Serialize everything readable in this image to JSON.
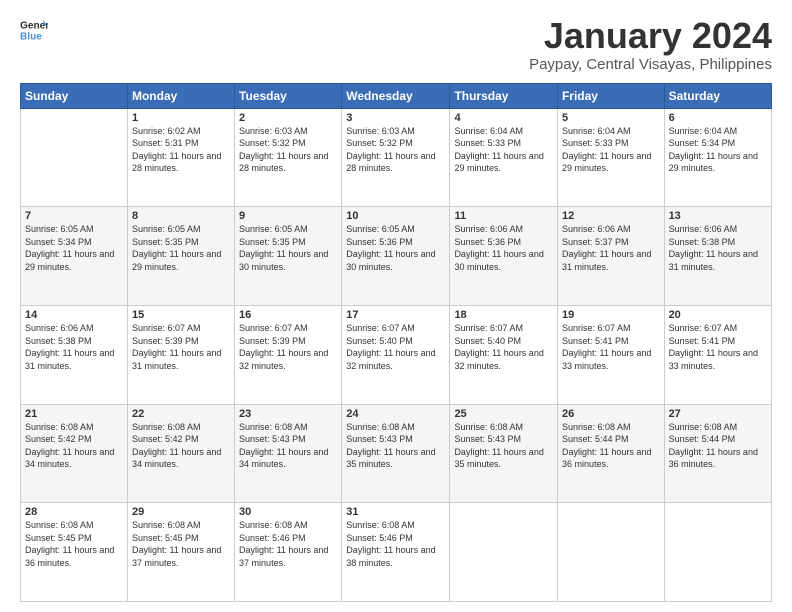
{
  "header": {
    "logo_general": "General",
    "logo_blue": "Blue",
    "month": "January 2024",
    "location": "Paypay, Central Visayas, Philippines"
  },
  "weekdays": [
    "Sunday",
    "Monday",
    "Tuesday",
    "Wednesday",
    "Thursday",
    "Friday",
    "Saturday"
  ],
  "weeks": [
    [
      {
        "day": "",
        "sunrise": "",
        "sunset": "",
        "daylight": ""
      },
      {
        "day": "1",
        "sunrise": "Sunrise: 6:02 AM",
        "sunset": "Sunset: 5:31 PM",
        "daylight": "Daylight: 11 hours and 28 minutes."
      },
      {
        "day": "2",
        "sunrise": "Sunrise: 6:03 AM",
        "sunset": "Sunset: 5:32 PM",
        "daylight": "Daylight: 11 hours and 28 minutes."
      },
      {
        "day": "3",
        "sunrise": "Sunrise: 6:03 AM",
        "sunset": "Sunset: 5:32 PM",
        "daylight": "Daylight: 11 hours and 28 minutes."
      },
      {
        "day": "4",
        "sunrise": "Sunrise: 6:04 AM",
        "sunset": "Sunset: 5:33 PM",
        "daylight": "Daylight: 11 hours and 29 minutes."
      },
      {
        "day": "5",
        "sunrise": "Sunrise: 6:04 AM",
        "sunset": "Sunset: 5:33 PM",
        "daylight": "Daylight: 11 hours and 29 minutes."
      },
      {
        "day": "6",
        "sunrise": "Sunrise: 6:04 AM",
        "sunset": "Sunset: 5:34 PM",
        "daylight": "Daylight: 11 hours and 29 minutes."
      }
    ],
    [
      {
        "day": "7",
        "sunrise": "Sunrise: 6:05 AM",
        "sunset": "Sunset: 5:34 PM",
        "daylight": "Daylight: 11 hours and 29 minutes."
      },
      {
        "day": "8",
        "sunrise": "Sunrise: 6:05 AM",
        "sunset": "Sunset: 5:35 PM",
        "daylight": "Daylight: 11 hours and 29 minutes."
      },
      {
        "day": "9",
        "sunrise": "Sunrise: 6:05 AM",
        "sunset": "Sunset: 5:35 PM",
        "daylight": "Daylight: 11 hours and 30 minutes."
      },
      {
        "day": "10",
        "sunrise": "Sunrise: 6:05 AM",
        "sunset": "Sunset: 5:36 PM",
        "daylight": "Daylight: 11 hours and 30 minutes."
      },
      {
        "day": "11",
        "sunrise": "Sunrise: 6:06 AM",
        "sunset": "Sunset: 5:36 PM",
        "daylight": "Daylight: 11 hours and 30 minutes."
      },
      {
        "day": "12",
        "sunrise": "Sunrise: 6:06 AM",
        "sunset": "Sunset: 5:37 PM",
        "daylight": "Daylight: 11 hours and 31 minutes."
      },
      {
        "day": "13",
        "sunrise": "Sunrise: 6:06 AM",
        "sunset": "Sunset: 5:38 PM",
        "daylight": "Daylight: 11 hours and 31 minutes."
      }
    ],
    [
      {
        "day": "14",
        "sunrise": "Sunrise: 6:06 AM",
        "sunset": "Sunset: 5:38 PM",
        "daylight": "Daylight: 11 hours and 31 minutes."
      },
      {
        "day": "15",
        "sunrise": "Sunrise: 6:07 AM",
        "sunset": "Sunset: 5:39 PM",
        "daylight": "Daylight: 11 hours and 31 minutes."
      },
      {
        "day": "16",
        "sunrise": "Sunrise: 6:07 AM",
        "sunset": "Sunset: 5:39 PM",
        "daylight": "Daylight: 11 hours and 32 minutes."
      },
      {
        "day": "17",
        "sunrise": "Sunrise: 6:07 AM",
        "sunset": "Sunset: 5:40 PM",
        "daylight": "Daylight: 11 hours and 32 minutes."
      },
      {
        "day": "18",
        "sunrise": "Sunrise: 6:07 AM",
        "sunset": "Sunset: 5:40 PM",
        "daylight": "Daylight: 11 hours and 32 minutes."
      },
      {
        "day": "19",
        "sunrise": "Sunrise: 6:07 AM",
        "sunset": "Sunset: 5:41 PM",
        "daylight": "Daylight: 11 hours and 33 minutes."
      },
      {
        "day": "20",
        "sunrise": "Sunrise: 6:07 AM",
        "sunset": "Sunset: 5:41 PM",
        "daylight": "Daylight: 11 hours and 33 minutes."
      }
    ],
    [
      {
        "day": "21",
        "sunrise": "Sunrise: 6:08 AM",
        "sunset": "Sunset: 5:42 PM",
        "daylight": "Daylight: 11 hours and 34 minutes."
      },
      {
        "day": "22",
        "sunrise": "Sunrise: 6:08 AM",
        "sunset": "Sunset: 5:42 PM",
        "daylight": "Daylight: 11 hours and 34 minutes."
      },
      {
        "day": "23",
        "sunrise": "Sunrise: 6:08 AM",
        "sunset": "Sunset: 5:43 PM",
        "daylight": "Daylight: 11 hours and 34 minutes."
      },
      {
        "day": "24",
        "sunrise": "Sunrise: 6:08 AM",
        "sunset": "Sunset: 5:43 PM",
        "daylight": "Daylight: 11 hours and 35 minutes."
      },
      {
        "day": "25",
        "sunrise": "Sunrise: 6:08 AM",
        "sunset": "Sunset: 5:43 PM",
        "daylight": "Daylight: 11 hours and 35 minutes."
      },
      {
        "day": "26",
        "sunrise": "Sunrise: 6:08 AM",
        "sunset": "Sunset: 5:44 PM",
        "daylight": "Daylight: 11 hours and 36 minutes."
      },
      {
        "day": "27",
        "sunrise": "Sunrise: 6:08 AM",
        "sunset": "Sunset: 5:44 PM",
        "daylight": "Daylight: 11 hours and 36 minutes."
      }
    ],
    [
      {
        "day": "28",
        "sunrise": "Sunrise: 6:08 AM",
        "sunset": "Sunset: 5:45 PM",
        "daylight": "Daylight: 11 hours and 36 minutes."
      },
      {
        "day": "29",
        "sunrise": "Sunrise: 6:08 AM",
        "sunset": "Sunset: 5:45 PM",
        "daylight": "Daylight: 11 hours and 37 minutes."
      },
      {
        "day": "30",
        "sunrise": "Sunrise: 6:08 AM",
        "sunset": "Sunset: 5:46 PM",
        "daylight": "Daylight: 11 hours and 37 minutes."
      },
      {
        "day": "31",
        "sunrise": "Sunrise: 6:08 AM",
        "sunset": "Sunset: 5:46 PM",
        "daylight": "Daylight: 11 hours and 38 minutes."
      },
      {
        "day": "",
        "sunrise": "",
        "sunset": "",
        "daylight": ""
      },
      {
        "day": "",
        "sunrise": "",
        "sunset": "",
        "daylight": ""
      },
      {
        "day": "",
        "sunrise": "",
        "sunset": "",
        "daylight": ""
      }
    ]
  ]
}
